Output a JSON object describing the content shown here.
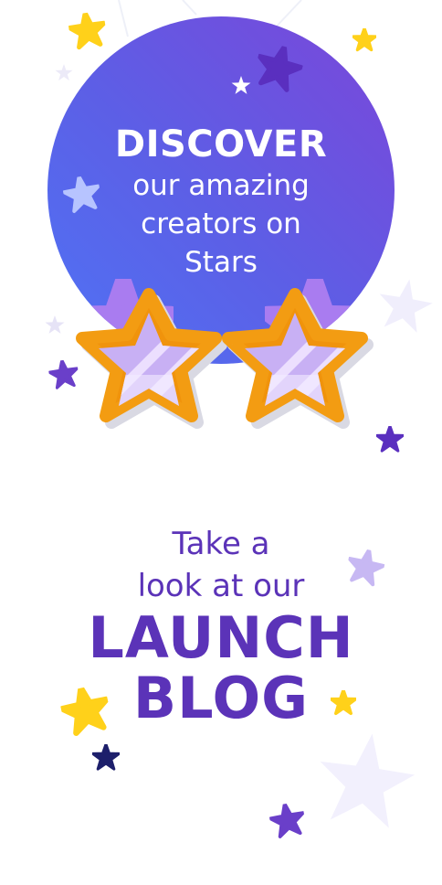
{
  "discover": {
    "heading": "DISCOVER",
    "line1": "our amazing",
    "line2": "creators on",
    "line3": "Stars"
  },
  "launch": {
    "intro1": "Take a",
    "intro2": "look at our",
    "heading1": "LAUNCH",
    "heading2": "BLOG"
  },
  "colors": {
    "gradient_start": "#4f73f5",
    "gradient_end": "#7b46d9",
    "accent_purple": "#5b33b8",
    "star_yellow": "#ffd11a",
    "glasses_orange": "#f0930c"
  }
}
